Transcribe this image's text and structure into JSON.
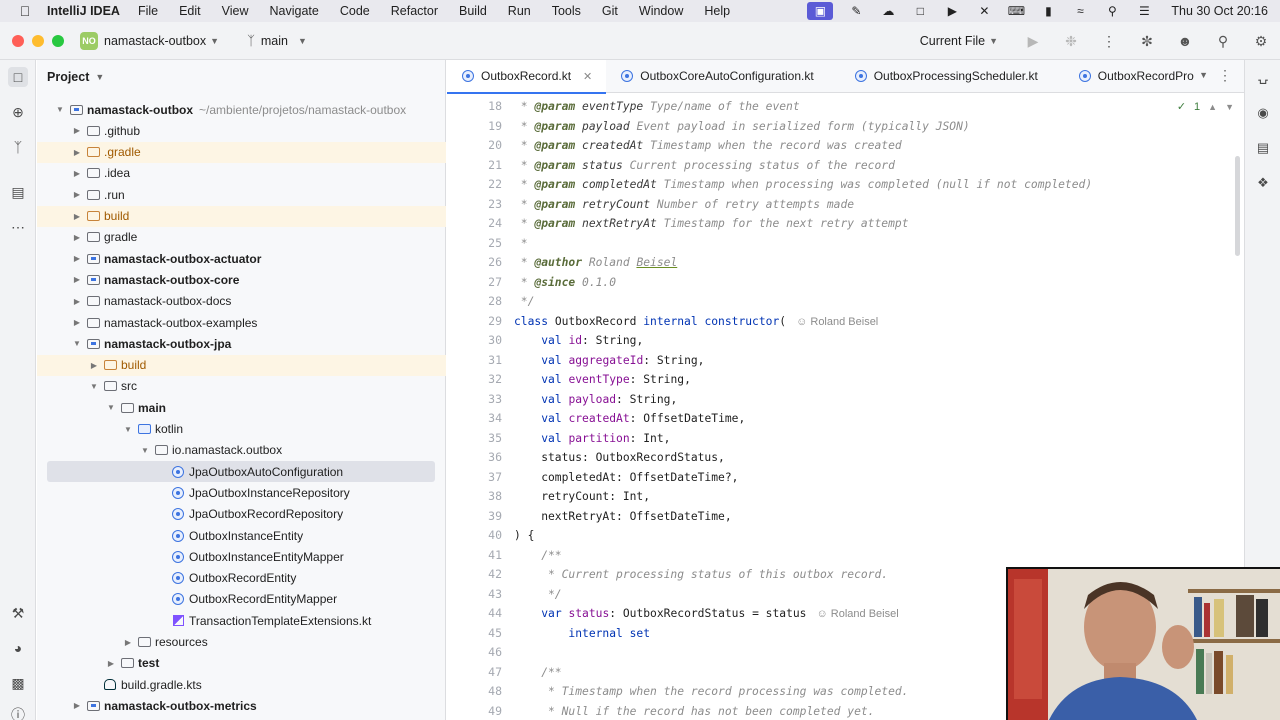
{
  "menubar": {
    "app_name": "IntelliJ IDEA",
    "items": [
      "File",
      "Edit",
      "View",
      "Navigate",
      "Code",
      "Refactor",
      "Build",
      "Run",
      "Tools",
      "Git",
      "Window",
      "Help"
    ],
    "clock": "Thu 30 Oct  20:16"
  },
  "titlebar": {
    "project_badge": "NO",
    "project_name": "namastack-outbox",
    "branch": "main",
    "run_config": "Current File"
  },
  "project_panel": {
    "title": "Project",
    "tree": [
      {
        "label": "namastack-outbox",
        "path": "~/ambiente/projetos/namastack-outbox",
        "depth": 0,
        "open": true,
        "icon": "module-folder",
        "bold": true
      },
      {
        "label": ".github",
        "depth": 1,
        "icon": "folder"
      },
      {
        "label": ".gradle",
        "depth": 1,
        "icon": "folder-excluded",
        "excluded": true
      },
      {
        "label": ".idea",
        "depth": 1,
        "icon": "folder"
      },
      {
        "label": ".run",
        "depth": 1,
        "icon": "folder"
      },
      {
        "label": "build",
        "depth": 1,
        "icon": "folder-excluded",
        "excluded": true
      },
      {
        "label": "gradle",
        "depth": 1,
        "icon": "folder"
      },
      {
        "label": "namastack-outbox-actuator",
        "depth": 1,
        "icon": "module-folder",
        "bold": true
      },
      {
        "label": "namastack-outbox-core",
        "depth": 1,
        "icon": "module-folder",
        "bold": true
      },
      {
        "label": "namastack-outbox-docs",
        "depth": 1,
        "icon": "folder"
      },
      {
        "label": "namastack-outbox-examples",
        "depth": 1,
        "icon": "folder"
      },
      {
        "label": "namastack-outbox-jpa",
        "depth": 1,
        "open": true,
        "icon": "module-folder",
        "bold": true
      },
      {
        "label": "build",
        "depth": 2,
        "icon": "folder-excluded",
        "excluded": true
      },
      {
        "label": "src",
        "depth": 2,
        "open": true,
        "icon": "folder"
      },
      {
        "label": "main",
        "depth": 3,
        "open": true,
        "icon": "folder",
        "bold": true
      },
      {
        "label": "kotlin",
        "depth": 4,
        "open": true,
        "icon": "folder-source"
      },
      {
        "label": "io.namastack.outbox",
        "depth": 5,
        "open": true,
        "icon": "package"
      },
      {
        "label": "JpaOutboxAutoConfiguration",
        "depth": 6,
        "icon": "class",
        "selected": true
      },
      {
        "label": "JpaOutboxInstanceRepository",
        "depth": 6,
        "icon": "class"
      },
      {
        "label": "JpaOutboxRecordRepository",
        "depth": 6,
        "icon": "class"
      },
      {
        "label": "OutboxInstanceEntity",
        "depth": 6,
        "icon": "class"
      },
      {
        "label": "OutboxInstanceEntityMapper",
        "depth": 6,
        "icon": "class"
      },
      {
        "label": "OutboxRecordEntity",
        "depth": 6,
        "icon": "class"
      },
      {
        "label": "OutboxRecordEntityMapper",
        "depth": 6,
        "icon": "class"
      },
      {
        "label": "TransactionTemplateExtensions.kt",
        "depth": 6,
        "icon": "kotlin-file"
      },
      {
        "label": "resources",
        "depth": 4,
        "icon": "folder"
      },
      {
        "label": "test",
        "depth": 3,
        "icon": "folder",
        "bold": true
      },
      {
        "label": "build.gradle.kts",
        "depth": 2,
        "icon": "gradle-file",
        "leaf": true
      },
      {
        "label": "namastack-outbox-metrics",
        "depth": 1,
        "icon": "module-folder",
        "bold": true
      }
    ]
  },
  "tabs": [
    {
      "label": "OutboxRecord.kt",
      "active": true
    },
    {
      "label": "OutboxCoreAutoConfiguration.kt"
    },
    {
      "label": "OutboxProcessingScheduler.kt"
    },
    {
      "label": "OutboxRecordPro"
    }
  ],
  "editor": {
    "inspection_count": "1",
    "author_inlay": "Roland Beisel",
    "lines": [
      {
        "n": "18",
        "parts": [
          [
            "cm",
            " * "
          ],
          [
            "tag",
            "@param"
          ],
          [
            "pname",
            " eventType"
          ],
          [
            "cm",
            " Type/name of the event"
          ]
        ]
      },
      {
        "n": "19",
        "parts": [
          [
            "cm",
            " * "
          ],
          [
            "tag",
            "@param"
          ],
          [
            "pname",
            " payload"
          ],
          [
            "cm",
            " Event payload in serialized form (typically JSON)"
          ]
        ]
      },
      {
        "n": "20",
        "parts": [
          [
            "cm",
            " * "
          ],
          [
            "tag",
            "@param"
          ],
          [
            "pname",
            " createdAt"
          ],
          [
            "cm",
            " Timestamp when the record was created"
          ]
        ]
      },
      {
        "n": "21",
        "parts": [
          [
            "cm",
            " * "
          ],
          [
            "tag",
            "@param"
          ],
          [
            "pname",
            " status"
          ],
          [
            "cm",
            " Current processing status of the record"
          ]
        ]
      },
      {
        "n": "22",
        "parts": [
          [
            "cm",
            " * "
          ],
          [
            "tag",
            "@param"
          ],
          [
            "pname",
            " completedAt"
          ],
          [
            "cm",
            " Timestamp when processing was completed (null if not completed)"
          ]
        ]
      },
      {
        "n": "23",
        "parts": [
          [
            "cm",
            " * "
          ],
          [
            "tag",
            "@param"
          ],
          [
            "pname",
            " retryCount"
          ],
          [
            "cm",
            " Number of retry attempts made"
          ]
        ]
      },
      {
        "n": "24",
        "parts": [
          [
            "cm",
            " * "
          ],
          [
            "tag",
            "@param"
          ],
          [
            "pname",
            " nextRetryAt"
          ],
          [
            "cm",
            " Timestamp for the next retry attempt"
          ]
        ]
      },
      {
        "n": "25",
        "parts": [
          [
            "cm",
            " *"
          ]
        ]
      },
      {
        "n": "26",
        "parts": [
          [
            "cm",
            " * "
          ],
          [
            "tag",
            "@author"
          ],
          [
            "cm",
            " Roland "
          ],
          [
            "cm under",
            "Beisel"
          ]
        ]
      },
      {
        "n": "27",
        "parts": [
          [
            "cm",
            " * "
          ],
          [
            "tag",
            "@since"
          ],
          [
            "cm",
            " 0.1.0"
          ]
        ]
      },
      {
        "n": "28",
        "parts": [
          [
            "cm",
            " */"
          ]
        ]
      },
      {
        "n": "29",
        "parts": [
          [
            "kw",
            "class"
          ],
          [
            "tp",
            " OutboxRecord "
          ],
          [
            "kw",
            "internal constructor"
          ],
          [
            "tp",
            "("
          ]
        ],
        "inlay": true
      },
      {
        "n": "30",
        "parts": [
          [
            "tp",
            "    "
          ],
          [
            "kw",
            "val "
          ],
          [
            "prop",
            "id"
          ],
          [
            "tp",
            ": String,"
          ]
        ]
      },
      {
        "n": "31",
        "parts": [
          [
            "tp",
            "    "
          ],
          [
            "kw",
            "val "
          ],
          [
            "prop",
            "aggregateId"
          ],
          [
            "tp",
            ": String,"
          ]
        ]
      },
      {
        "n": "32",
        "parts": [
          [
            "tp",
            "    "
          ],
          [
            "kw",
            "val "
          ],
          [
            "prop",
            "eventType"
          ],
          [
            "tp",
            ": String,"
          ]
        ]
      },
      {
        "n": "33",
        "parts": [
          [
            "tp",
            "    "
          ],
          [
            "kw",
            "val "
          ],
          [
            "prop",
            "payload"
          ],
          [
            "tp",
            ": String,"
          ]
        ]
      },
      {
        "n": "34",
        "parts": [
          [
            "tp",
            "    "
          ],
          [
            "kw",
            "val "
          ],
          [
            "prop",
            "createdAt"
          ],
          [
            "tp",
            ": OffsetDateTime,"
          ]
        ]
      },
      {
        "n": "35",
        "parts": [
          [
            "tp",
            "    "
          ],
          [
            "kw",
            "val "
          ],
          [
            "prop",
            "partition"
          ],
          [
            "tp",
            ": Int,"
          ]
        ]
      },
      {
        "n": "36",
        "parts": [
          [
            "tp",
            "    status: OutboxRecordStatus,"
          ]
        ]
      },
      {
        "n": "37",
        "parts": [
          [
            "tp",
            "    completedAt: OffsetDateTime?,"
          ]
        ]
      },
      {
        "n": "38",
        "parts": [
          [
            "tp",
            "    retryCount: Int,"
          ]
        ]
      },
      {
        "n": "39",
        "parts": [
          [
            "tp",
            "    nextRetryAt: OffsetDateTime,"
          ]
        ]
      },
      {
        "n": "40",
        "parts": [
          [
            "tp",
            ") {"
          ]
        ]
      },
      {
        "n": "41",
        "parts": [
          [
            "cm",
            "    /**"
          ]
        ]
      },
      {
        "n": "42",
        "parts": [
          [
            "cm",
            "     * Current processing status of this outbox record."
          ]
        ]
      },
      {
        "n": "43",
        "parts": [
          [
            "cm",
            "     */"
          ]
        ]
      },
      {
        "n": "44",
        "parts": [
          [
            "tp",
            "    "
          ],
          [
            "kw",
            "var "
          ],
          [
            "prop",
            "status"
          ],
          [
            "tp",
            ": OutboxRecordStatus = status"
          ]
        ],
        "inlay": true
      },
      {
        "n": "45",
        "parts": [
          [
            "tp",
            "        "
          ],
          [
            "kw",
            "internal set"
          ]
        ]
      },
      {
        "n": "46",
        "parts": [
          [
            "tp",
            ""
          ]
        ]
      },
      {
        "n": "47",
        "parts": [
          [
            "cm",
            "    /**"
          ]
        ]
      },
      {
        "n": "48",
        "parts": [
          [
            "cm",
            "     * Timestamp when the record processing was completed."
          ]
        ]
      },
      {
        "n": "49",
        "parts": [
          [
            "cm",
            "     * Null if the record has not been completed yet."
          ]
        ]
      }
    ]
  }
}
